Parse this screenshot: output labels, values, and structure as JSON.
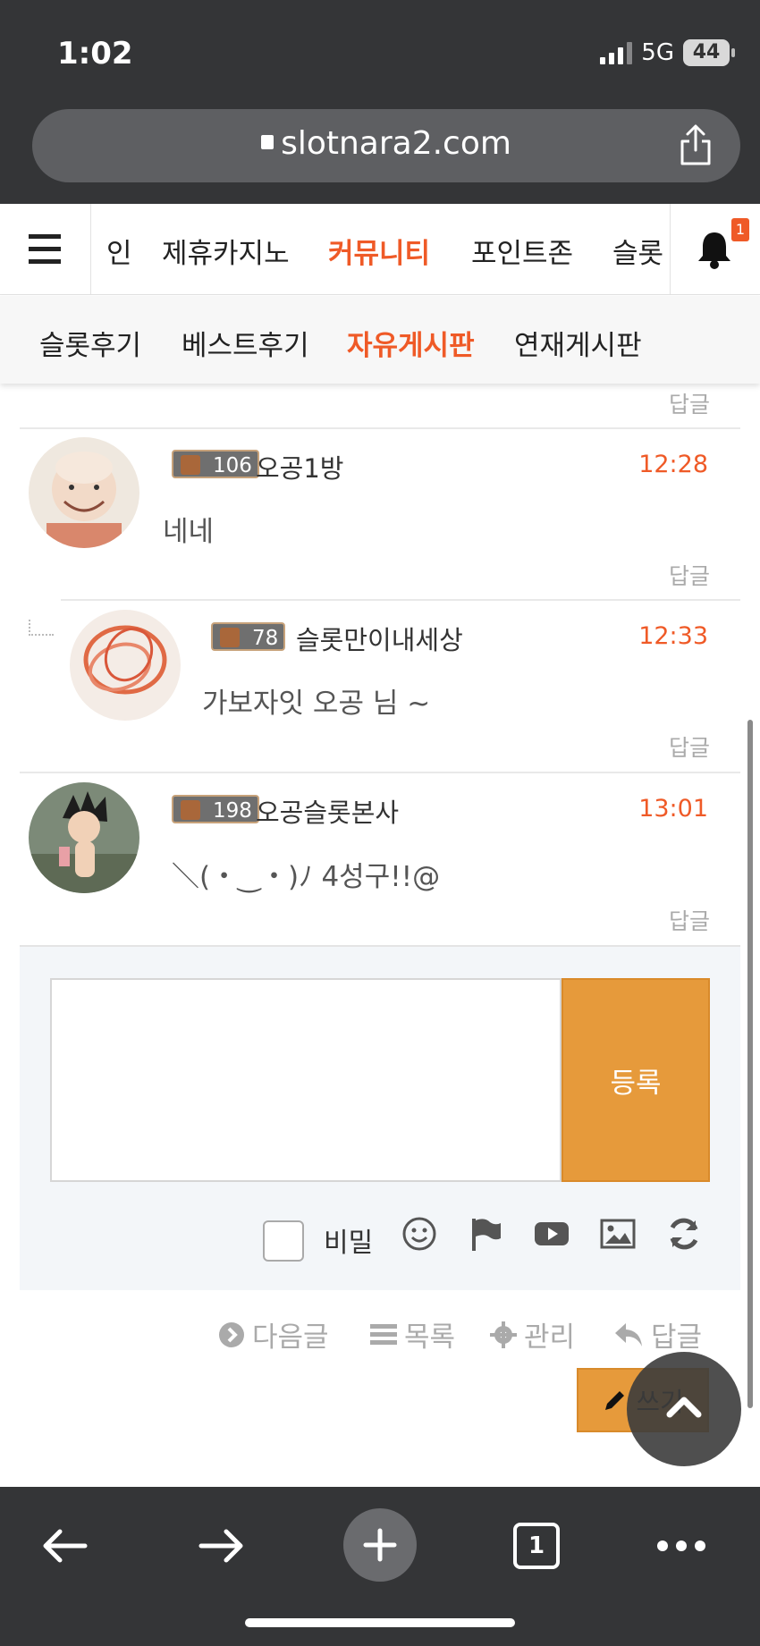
{
  "status": {
    "time": "1:02",
    "network": "5G",
    "battery": "44"
  },
  "browser": {
    "url": "slotnara2.com",
    "tab_count": "1"
  },
  "site_nav": {
    "items": [
      {
        "label": "인"
      },
      {
        "label": "제휴카지노"
      },
      {
        "label": "커뮤니티",
        "active": true
      },
      {
        "label": "포인트존"
      },
      {
        "label": "슬롯"
      }
    ],
    "notification_count": "1"
  },
  "sub_nav": {
    "items": [
      {
        "label": "슬롯후기"
      },
      {
        "label": "베스트후기"
      },
      {
        "label": "자유게시판",
        "active": true
      },
      {
        "label": "연재게시판"
      }
    ]
  },
  "comments": [
    {
      "level": "106",
      "nickname": "오공1방",
      "time": "12:28",
      "text": "네네",
      "reply_label": "답글",
      "is_reply": false
    },
    {
      "level": "78",
      "nickname": "슬롯만이내세상",
      "time": "12:33",
      "text": "가보자잇 오공 님 ~",
      "reply_label": "답글",
      "is_reply": true
    },
    {
      "level": "198",
      "nickname": "오공슬롯본사",
      "time": "13:01",
      "text": "＼(・‿・)ﾉ  4성구!!@",
      "reply_label": "답글",
      "is_reply": false
    }
  ],
  "top_reply_label": "답글",
  "comment_form": {
    "submit_label": "등록",
    "secret_label": "비밀"
  },
  "actions": {
    "next": "다음글",
    "list": "목록",
    "manage": "관리",
    "reply": "답글",
    "write": "쓰기"
  },
  "colors": {
    "accent": "#ef5a27",
    "button": "#e69a3b",
    "chrome": "#343537"
  }
}
